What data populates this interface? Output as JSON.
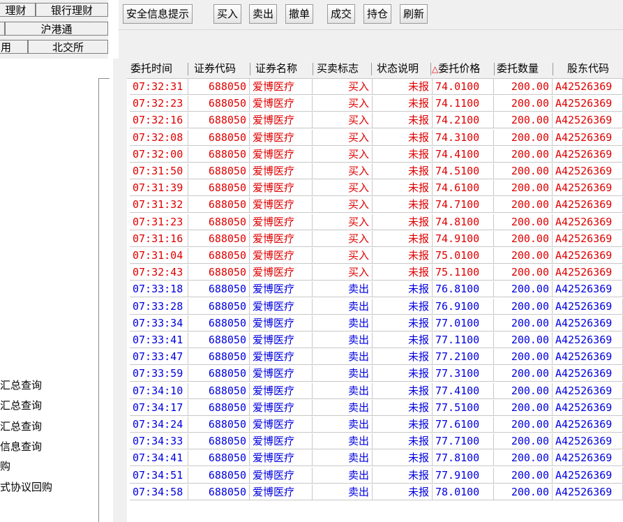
{
  "left": {
    "tabs": [
      {
        "label": "理财"
      },
      {
        "label": "银行理财"
      },
      {
        "label": ""
      },
      {
        "label": "沪港通"
      },
      {
        "label": "用"
      },
      {
        "label": "北交所"
      }
    ],
    "menu": [
      {
        "label": "汇总查询"
      },
      {
        "label": "汇总查询"
      },
      {
        "label": "汇总查询"
      },
      {
        "label": "信息查询"
      },
      {
        "label": "购"
      },
      {
        "label": "式协议回购"
      }
    ]
  },
  "toolbar": {
    "buttons": [
      {
        "label": "安全信息提示"
      },
      {
        "label": "买入"
      },
      {
        "label": "卖出"
      },
      {
        "label": "撤单"
      },
      {
        "label": "成交"
      },
      {
        "label": "持仓"
      },
      {
        "label": "刷新"
      }
    ]
  },
  "table": {
    "columns": [
      "委托时间",
      "证券代码",
      "证券名称",
      "买卖标志",
      "状态说明",
      "委托价格",
      "委托数量",
      "股东代码"
    ],
    "price_warning_mark": "△",
    "colors": {
      "buy": "#e00000",
      "sell": "#0000e0"
    },
    "rows": [
      {
        "time": "07:32:31",
        "code": "688050",
        "name": "爱博医疗",
        "side": "买入",
        "status": "未报",
        "price": "74.0100",
        "qty": "200.00",
        "holder": "A42526369"
      },
      {
        "time": "07:32:23",
        "code": "688050",
        "name": "爱博医疗",
        "side": "买入",
        "status": "未报",
        "price": "74.1100",
        "qty": "200.00",
        "holder": "A42526369"
      },
      {
        "time": "07:32:16",
        "code": "688050",
        "name": "爱博医疗",
        "side": "买入",
        "status": "未报",
        "price": "74.2100",
        "qty": "200.00",
        "holder": "A42526369"
      },
      {
        "time": "07:32:08",
        "code": "688050",
        "name": "爱博医疗",
        "side": "买入",
        "status": "未报",
        "price": "74.3100",
        "qty": "200.00",
        "holder": "A42526369"
      },
      {
        "time": "07:32:00",
        "code": "688050",
        "name": "爱博医疗",
        "side": "买入",
        "status": "未报",
        "price": "74.4100",
        "qty": "200.00",
        "holder": "A42526369"
      },
      {
        "time": "07:31:50",
        "code": "688050",
        "name": "爱博医疗",
        "side": "买入",
        "status": "未报",
        "price": "74.5100",
        "qty": "200.00",
        "holder": "A42526369"
      },
      {
        "time": "07:31:39",
        "code": "688050",
        "name": "爱博医疗",
        "side": "买入",
        "status": "未报",
        "price": "74.6100",
        "qty": "200.00",
        "holder": "A42526369"
      },
      {
        "time": "07:31:32",
        "code": "688050",
        "name": "爱博医疗",
        "side": "买入",
        "status": "未报",
        "price": "74.7100",
        "qty": "200.00",
        "holder": "A42526369"
      },
      {
        "time": "07:31:23",
        "code": "688050",
        "name": "爱博医疗",
        "side": "买入",
        "status": "未报",
        "price": "74.8100",
        "qty": "200.00",
        "holder": "A42526369"
      },
      {
        "time": "07:31:16",
        "code": "688050",
        "name": "爱博医疗",
        "side": "买入",
        "status": "未报",
        "price": "74.9100",
        "qty": "200.00",
        "holder": "A42526369"
      },
      {
        "time": "07:31:04",
        "code": "688050",
        "name": "爱博医疗",
        "side": "买入",
        "status": "未报",
        "price": "75.0100",
        "qty": "200.00",
        "holder": "A42526369"
      },
      {
        "time": "07:32:43",
        "code": "688050",
        "name": "爱博医疗",
        "side": "买入",
        "status": "未报",
        "price": "75.1100",
        "qty": "200.00",
        "holder": "A42526369"
      },
      {
        "time": "07:33:18",
        "code": "688050",
        "name": "爱博医疗",
        "side": "卖出",
        "status": "未报",
        "price": "76.8100",
        "qty": "200.00",
        "holder": "A42526369"
      },
      {
        "time": "07:33:28",
        "code": "688050",
        "name": "爱博医疗",
        "side": "卖出",
        "status": "未报",
        "price": "76.9100",
        "qty": "200.00",
        "holder": "A42526369"
      },
      {
        "time": "07:33:34",
        "code": "688050",
        "name": "爱博医疗",
        "side": "卖出",
        "status": "未报",
        "price": "77.0100",
        "qty": "200.00",
        "holder": "A42526369"
      },
      {
        "time": "07:33:41",
        "code": "688050",
        "name": "爱博医疗",
        "side": "卖出",
        "status": "未报",
        "price": "77.1100",
        "qty": "200.00",
        "holder": "A42526369"
      },
      {
        "time": "07:33:47",
        "code": "688050",
        "name": "爱博医疗",
        "side": "卖出",
        "status": "未报",
        "price": "77.2100",
        "qty": "200.00",
        "holder": "A42526369"
      },
      {
        "time": "07:33:59",
        "code": "688050",
        "name": "爱博医疗",
        "side": "卖出",
        "status": "未报",
        "price": "77.3100",
        "qty": "200.00",
        "holder": "A42526369"
      },
      {
        "time": "07:34:10",
        "code": "688050",
        "name": "爱博医疗",
        "side": "卖出",
        "status": "未报",
        "price": "77.4100",
        "qty": "200.00",
        "holder": "A42526369"
      },
      {
        "time": "07:34:17",
        "code": "688050",
        "name": "爱博医疗",
        "side": "卖出",
        "status": "未报",
        "price": "77.5100",
        "qty": "200.00",
        "holder": "A42526369"
      },
      {
        "time": "07:34:24",
        "code": "688050",
        "name": "爱博医疗",
        "side": "卖出",
        "status": "未报",
        "price": "77.6100",
        "qty": "200.00",
        "holder": "A42526369"
      },
      {
        "time": "07:34:33",
        "code": "688050",
        "name": "爱博医疗",
        "side": "卖出",
        "status": "未报",
        "price": "77.7100",
        "qty": "200.00",
        "holder": "A42526369"
      },
      {
        "time": "07:34:41",
        "code": "688050",
        "name": "爱博医疗",
        "side": "卖出",
        "status": "未报",
        "price": "77.8100",
        "qty": "200.00",
        "holder": "A42526369"
      },
      {
        "time": "07:34:51",
        "code": "688050",
        "name": "爱博医疗",
        "side": "卖出",
        "status": "未报",
        "price": "77.9100",
        "qty": "200.00",
        "holder": "A42526369"
      },
      {
        "time": "07:34:58",
        "code": "688050",
        "name": "爱博医疗",
        "side": "卖出",
        "status": "未报",
        "price": "78.0100",
        "qty": "200.00",
        "holder": "A42526369"
      }
    ]
  }
}
